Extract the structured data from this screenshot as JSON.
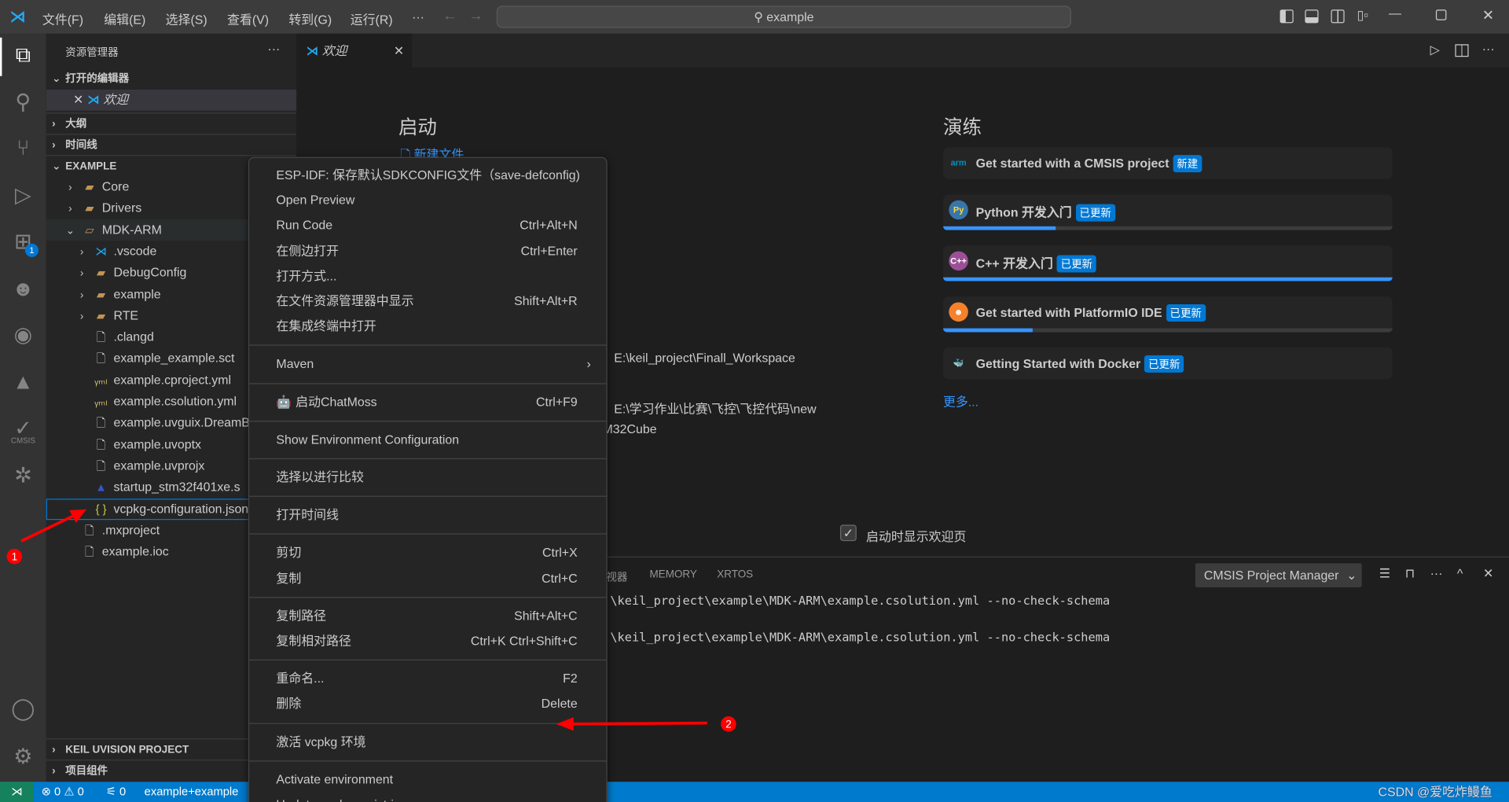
{
  "titlebar": {
    "menus": [
      "文件(F)",
      "编辑(E)",
      "选择(S)",
      "查看(V)",
      "转到(G)",
      "运行(R)",
      "···"
    ],
    "search": "example"
  },
  "activity": {
    "items": [
      {
        "icon": "files-icon"
      },
      {
        "icon": "search-icon"
      },
      {
        "icon": "source-control-icon"
      },
      {
        "icon": "run-debug-icon"
      },
      {
        "icon": "extensions-icon",
        "badge": "1"
      },
      {
        "icon": "platformio-icon"
      },
      {
        "icon": "espressif-icon"
      },
      {
        "icon": "cmake-icon"
      },
      {
        "icon": "cmsis-icon",
        "label": "CMSIS"
      },
      {
        "icon": "keil-chip-icon"
      }
    ],
    "account_icon": "account-icon",
    "settings_icon": "gear-icon"
  },
  "sidebar": {
    "title": "资源管理器",
    "more": "···",
    "open_editors": "打开的编辑器",
    "open_item": "欢迎",
    "outline": "大纲",
    "timeline": "时间线",
    "folder": "EXAMPLE",
    "keil": "KEIL UVISION PROJECT",
    "components": "项目组件",
    "tree": [
      {
        "name": "Core",
        "type": "folder",
        "depth": 1,
        "state": ">"
      },
      {
        "name": "Drivers",
        "type": "folder",
        "depth": 1,
        "state": ">"
      },
      {
        "name": "MDK-ARM",
        "type": "folder-open",
        "depth": 1,
        "state": "v"
      },
      {
        "name": ".vscode",
        "type": "vscode",
        "depth": 2,
        "state": ">"
      },
      {
        "name": "DebugConfig",
        "type": "folder",
        "depth": 2,
        "state": ">"
      },
      {
        "name": "example",
        "type": "folder",
        "depth": 2,
        "state": ">"
      },
      {
        "name": "RTE",
        "type": "folder",
        "depth": 2,
        "state": ">"
      },
      {
        "name": ".clangd",
        "type": "file",
        "depth": 2
      },
      {
        "name": "example_example.sct",
        "type": "file",
        "depth": 2
      },
      {
        "name": "example.cproject.yml",
        "type": "yml",
        "depth": 2
      },
      {
        "name": "example.csolution.yml",
        "type": "yml",
        "depth": 2
      },
      {
        "name": "example.uvguix.DreamBa",
        "type": "file",
        "depth": 2
      },
      {
        "name": "example.uvoptx",
        "type": "file",
        "depth": 2
      },
      {
        "name": "example.uvprojx",
        "type": "file",
        "depth": 2
      },
      {
        "name": "startup_stm32f401xe.s",
        "type": "asm",
        "depth": 2
      },
      {
        "name": "vcpkg-configuration.json",
        "type": "json",
        "depth": 2,
        "focused": true
      },
      {
        "name": ".mxproject",
        "type": "file",
        "depth": 1
      },
      {
        "name": "example.ioc",
        "type": "file",
        "depth": 1
      }
    ]
  },
  "editor": {
    "tab": "欢迎",
    "start_title": "启动",
    "new_file": "新建文件",
    "recent": [
      "E:\\keil_project\\Finall_Workspace",
      "E:\\学习作业\\比赛\\飞控\\飞控代码\\new"
    ],
    "recent_fragment": "M32Cube",
    "walk_title": "演练",
    "more": "更多...",
    "show_on_startup": "启动时显示欢迎页",
    "show_on_startup_checked": true,
    "walkthroughs": [
      {
        "title": "Get started with a CMSIS project",
        "badge": "新建",
        "icon": "arm-icon",
        "progress": null
      },
      {
        "title": "Python 开发入门",
        "badge": "已更新",
        "icon": "python-icon",
        "progress": 0.25
      },
      {
        "title": "C++ 开发入门",
        "badge": "已更新",
        "icon": "cpp-icon",
        "progress": 1
      },
      {
        "title": "Get started with PlatformIO IDE",
        "badge": "已更新",
        "icon": "platformio-icon",
        "progress": 0.2
      },
      {
        "title": "Getting Started with Docker",
        "badge": "已更新",
        "icon": "docker-icon",
        "progress": null
      }
    ]
  },
  "panel": {
    "tabs": [
      "视器",
      "MEMORY",
      "XRTOS"
    ],
    "dropdown": "CMSIS Project Manager",
    "lines": [
      "\\keil_project\\example\\MDK-ARM\\example.csolution.yml --no-check-schema",
      "\\keil_project\\example\\MDK-ARM\\example.csolution.yml --no-check-schema"
    ]
  },
  "statusbar": {
    "errors": "0",
    "warnings": "0",
    "ports": "0",
    "project": "example+example",
    "watermark": "CSDN @爱吃炸鳗鱼"
  },
  "context_menu": {
    "groups": [
      [
        {
          "label": "ESP-IDF: 保存默认SDKCONFIG文件（save-defconfig)"
        },
        {
          "label": "Open Preview"
        },
        {
          "label": "Run Code",
          "shortcut": "Ctrl+Alt+N"
        },
        {
          "label": "在侧边打开",
          "shortcut": "Ctrl+Enter"
        },
        {
          "label": "打开方式..."
        },
        {
          "label": "在文件资源管理器中显示",
          "shortcut": "Shift+Alt+R"
        },
        {
          "label": "在集成终端中打开"
        }
      ],
      [
        {
          "label": "Maven",
          "submenu": true
        }
      ],
      [
        {
          "label": "启动ChatMoss",
          "shortcut": "Ctrl+F9",
          "icon": "robot-icon"
        }
      ],
      [
        {
          "label": "Show Environment Configuration"
        }
      ],
      [
        {
          "label": "选择以进行比较"
        }
      ],
      [
        {
          "label": "打开时间线"
        }
      ],
      [
        {
          "label": "剪切",
          "shortcut": "Ctrl+X"
        },
        {
          "label": "复制",
          "shortcut": "Ctrl+C"
        }
      ],
      [
        {
          "label": "复制路径",
          "shortcut": "Shift+Alt+C"
        },
        {
          "label": "复制相对路径",
          "shortcut": "Ctrl+K Ctrl+Shift+C"
        }
      ],
      [
        {
          "label": "重命名...",
          "shortcut": "F2"
        },
        {
          "label": "删除",
          "shortcut": "Delete"
        }
      ],
      [
        {
          "label": "激活 vcpkg 环境"
        }
      ],
      [
        {
          "label": "Activate environment"
        },
        {
          "label": "Update vcpkg registries"
        }
      ]
    ]
  },
  "annotations": {
    "marker1": "1",
    "marker2": "2",
    "color": "#ff0000"
  },
  "colors": {
    "accent": "#007acc",
    "badge": "#0078d4",
    "remote": "#16825d",
    "folder": "#c09553"
  }
}
